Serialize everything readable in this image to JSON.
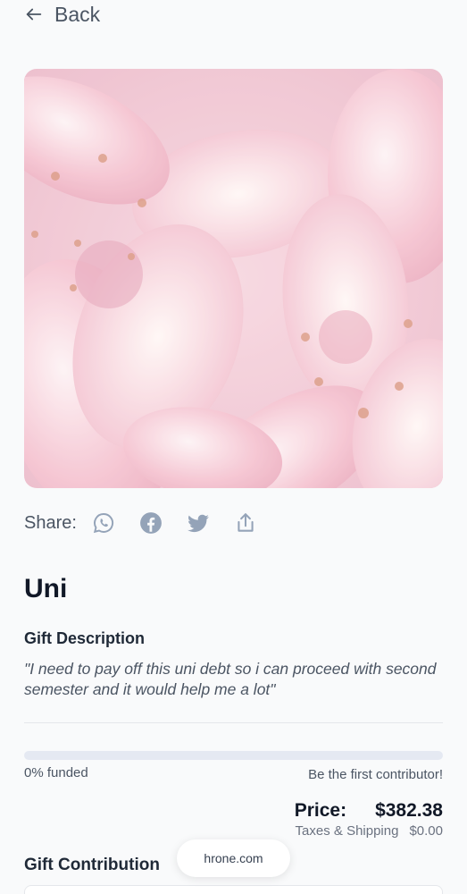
{
  "nav": {
    "back_label": "Back"
  },
  "hero": {
    "alt": "Pink lilies"
  },
  "share": {
    "label": "Share:",
    "icons": [
      "whatsapp-icon",
      "facebook-icon",
      "twitter-icon",
      "upload-share-icon"
    ]
  },
  "gift": {
    "title": "Uni",
    "description_heading": "Gift Description",
    "description": "\"I need to pay off this uni debt so i can proceed with second semester and it would help me a lot\""
  },
  "funding": {
    "percent": 0,
    "funded_label": "0% funded",
    "cta": "Be the first contributor!"
  },
  "pricing": {
    "price_label": "Price:",
    "price_value": "$382.38",
    "tax_label": "Taxes & Shipping",
    "tax_value": "$0.00"
  },
  "contribution": {
    "heading": "Gift Contribution"
  },
  "toast": {
    "text": "hrone.com"
  },
  "colors": {
    "accent": "#6366f1",
    "icon": "#94a3b8",
    "track": "#e5e9f2"
  }
}
